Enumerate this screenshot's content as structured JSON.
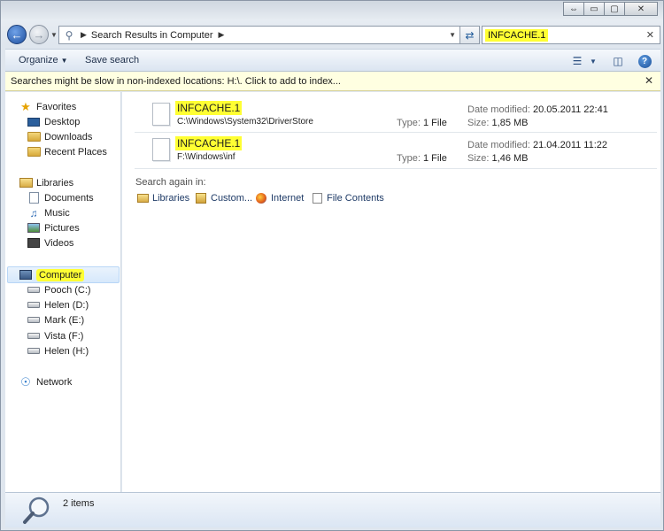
{
  "window": {
    "caption_buttons": [
      "⇔",
      "▭",
      "▢",
      "✕"
    ]
  },
  "address": {
    "crumb": "Search Results in Computer",
    "search_value": "INFCACHE.1"
  },
  "toolbar": {
    "organize": "Organize",
    "save_search": "Save search"
  },
  "infobar": {
    "text": "Searches might be slow in non-indexed locations: H:\\. Click to add to index..."
  },
  "nav": {
    "favorites": {
      "label": "Favorites",
      "items": [
        "Desktop",
        "Downloads",
        "Recent Places"
      ]
    },
    "libraries": {
      "label": "Libraries",
      "items": [
        "Documents",
        "Music",
        "Pictures",
        "Videos"
      ]
    },
    "computer": {
      "label": "Computer",
      "items": [
        "Pooch (C:)",
        "Helen (D:)",
        "Mark (E:)",
        "Vista (F:)",
        "Helen (H:)"
      ]
    },
    "network": {
      "label": "Network"
    }
  },
  "results": [
    {
      "name": "INFCACHE.1",
      "path": "C:\\Windows\\System32\\DriverStore",
      "type_label": "Type:",
      "type": "1 File",
      "modified_label": "Date modified:",
      "modified": "20.05.2011 22:41",
      "size_label": "Size:",
      "size": "1,85 MB"
    },
    {
      "name": "INFCACHE.1",
      "path": "F:\\Windows\\inf",
      "type_label": "Type:",
      "type": "1 File",
      "modified_label": "Date modified:",
      "modified": "21.04.2011 11:22",
      "size_label": "Size:",
      "size": "1,46 MB"
    }
  ],
  "search_again": {
    "title": "Search again in:",
    "options": [
      "Libraries",
      "Custom...",
      "Internet",
      "File Contents"
    ]
  },
  "status": {
    "count": "2 items"
  },
  "colors": {
    "highlight": "#ffff33",
    "infobar_bg": "#ffffe1",
    "selection": "#d6e8fb"
  }
}
